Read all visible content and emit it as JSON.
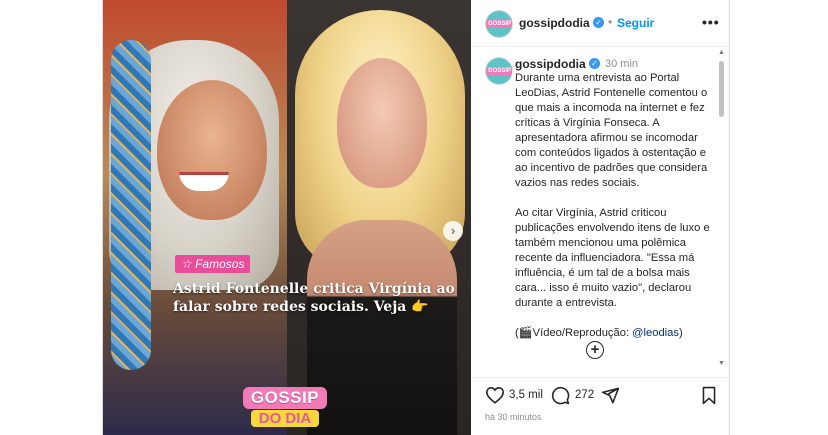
{
  "post": {
    "username": "gossipdodia",
    "follow_label": "Seguir",
    "more_label": "•••",
    "time_ago": "30 min",
    "posted_ago": "há 30 minutos",
    "media": {
      "tag": "☆ Famosos",
      "headline": "Astrid Fontenelle critica Virgínia ao falar sobre redes sociais. Veja 👉",
      "logo_top": "GOSSIP",
      "logo_bottom": "DO DIA",
      "next_arrow": "›"
    },
    "caption": {
      "paragraph1": "Durante uma entrevista ao Portal LeoDias, Astrid Fontenelle comentou o que mais a incomoda na internet e fez críticas à Virgínia Fonseca. A apresentadora afirmou se incomodar com conteúdos ligados à ostentação e ao incentivo de padrões que considera vazios nas redes sociais.",
      "paragraph2": "Ao citar Virgínia, Astrid criticou publicações envolvendo itens de luxo e também mencionou uma polêmica recente da influenciadora. \"Essa má influência, é um tal de a bolsa mais cara... isso é muito vazio\", declarou durante a entrevista.",
      "credit_prefix": "(🎬Vídeo/Reprodução: ",
      "credit_mention": "@leodias",
      "credit_suffix": ")"
    },
    "likes": "3,5 mil",
    "comments": "272"
  },
  "colors": {
    "follow": "#0095f6",
    "verified": "#3897f0",
    "tag": "#e84c9a",
    "logo_pink": "#f07bb8",
    "logo_yellow": "#f4d83c"
  }
}
